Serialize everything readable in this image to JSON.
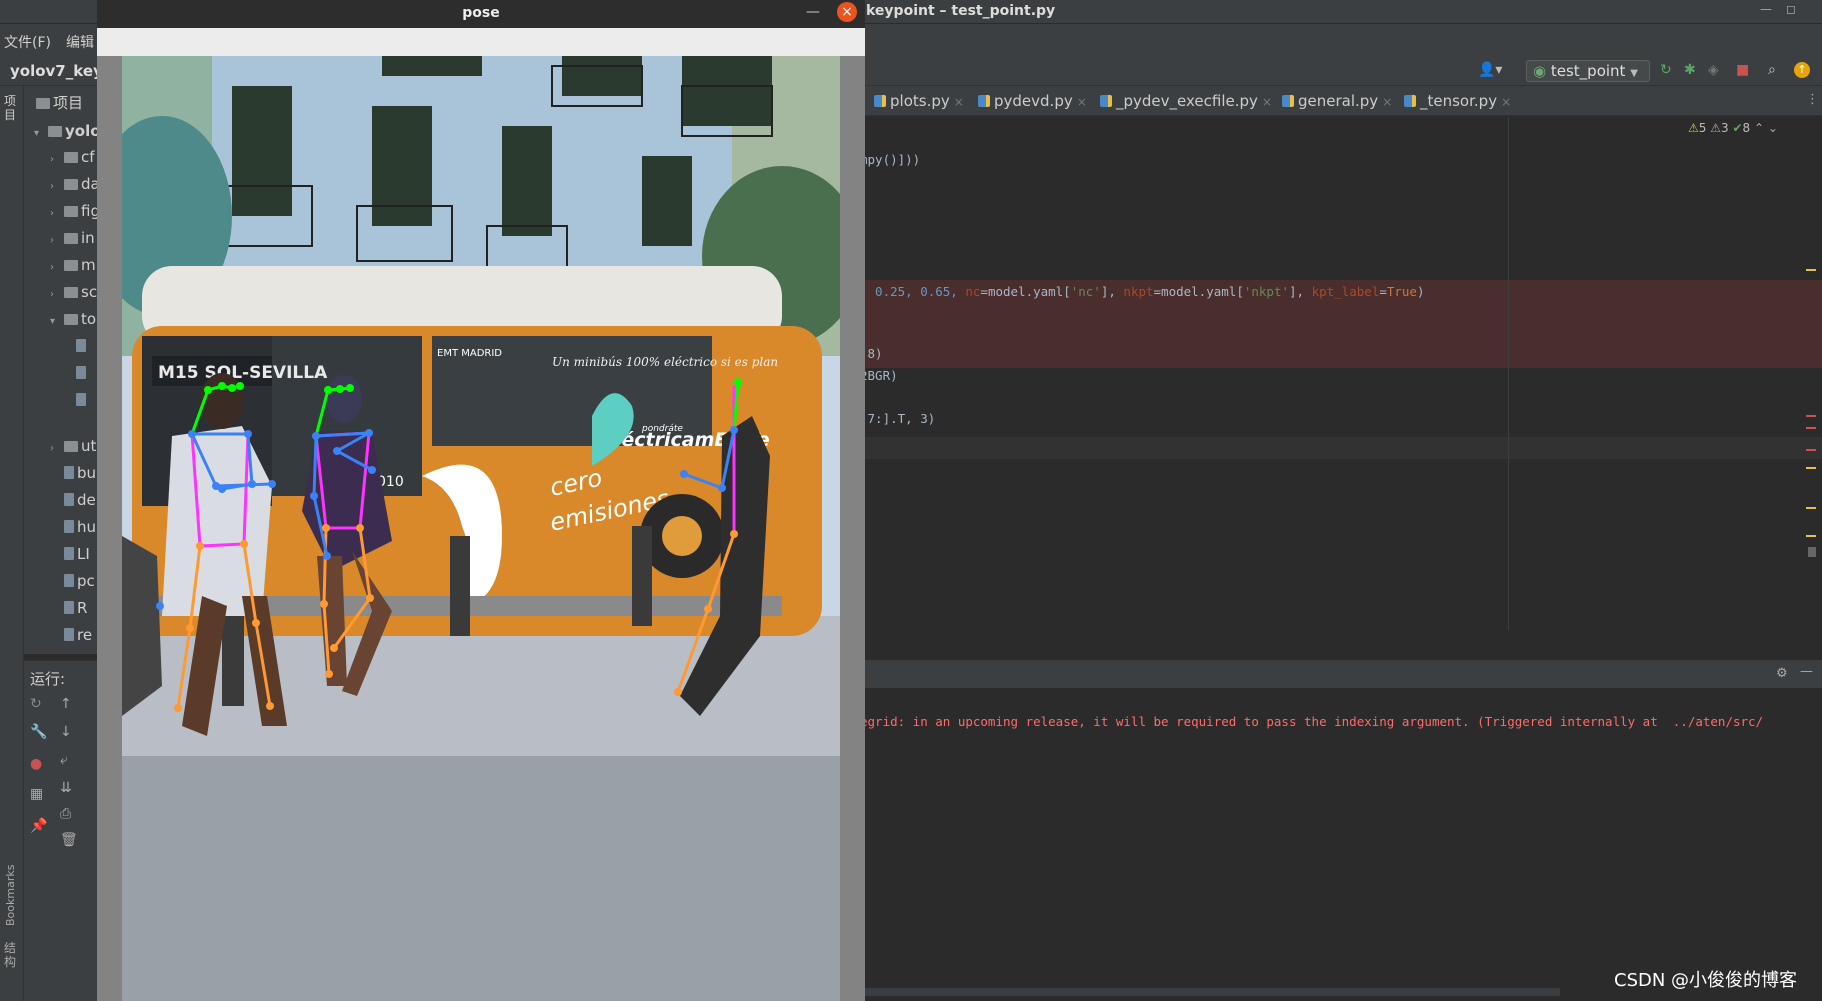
{
  "ide": {
    "window_title": "keypoint – test_point.py",
    "menu": [
      "文件(F)",
      "编辑"
    ],
    "project_name": "yolov7_keyp",
    "run_config": "test_point",
    "project_panel_label": "项目",
    "run_label": "运行:",
    "left_stripe": {
      "project": "项目",
      "bookmarks": "Bookmarks",
      "structure": "结构"
    },
    "tabs": [
      "plots.py",
      "pydevd.py",
      "_pydev_execfile.py",
      "general.py",
      "_tensor.py"
    ],
    "inspections": {
      "warnings": "5",
      "weak_warnings": "3",
      "ok": "8"
    },
    "tree": [
      {
        "label": "yolo",
        "expanded": true,
        "bold": true
      },
      {
        "label": "cf",
        "type": "folder"
      },
      {
        "label": "da",
        "type": "folder"
      },
      {
        "label": "fig",
        "type": "folder"
      },
      {
        "label": "in",
        "type": "folder"
      },
      {
        "label": "m",
        "type": "folder"
      },
      {
        "label": "sc",
        "type": "folder"
      },
      {
        "label": "to",
        "type": "folder",
        "expanded": true
      },
      {
        "label": "ut",
        "type": "folder"
      },
      {
        "label": "bu",
        "type": "file"
      },
      {
        "label": "de",
        "type": "file"
      },
      {
        "label": "hu",
        "type": "file"
      },
      {
        "label": "LI",
        "type": "file"
      },
      {
        "label": "pc",
        "type": "file"
      },
      {
        "label": "R",
        "type": "file"
      },
      {
        "label": "re",
        "type": "file"
      }
    ],
    "code_lines": [
      {
        "text": "mpy()]))"
      },
      {
        "text": ", 0.25, 0.65, nc=model.yaml['nc'], nkpt=model.yaml['nkpt'], kpt_label=True)"
      },
      {
        "text": ":8)"
      },
      {
        "text": "2BGR)"
      },
      {
        "text": " 7:].T, 3)"
      }
    ],
    "console_text": "egrid: in an upcoming release, it will be required to pass the indexing argument. (Triggered internally at  ../aten/src/"
  },
  "pose_window": {
    "title": "pose"
  },
  "image": {
    "bus_sign_top": "M15 SOL-SEVILLA",
    "bus_ad": "Un minibús 100% eléctrico si es plan",
    "bus_brand": "eléctricamEMTe",
    "bus_brand_small": "pondráte",
    "bus_slogan_1": "cero",
    "bus_slogan_2": "emisiones",
    "bus_emt": "EMT MADRID",
    "bus_number": "010"
  },
  "watermark": "CSDN @小俊俊的博客",
  "colors": {
    "close_button": "#e95420",
    "error_highlight": "#4a2d2d",
    "skeleton_face": "#00ff00",
    "skeleton_arms": "#3b82f6",
    "skeleton_torso": "#ff33ff",
    "skeleton_legs": "#ff9933"
  }
}
